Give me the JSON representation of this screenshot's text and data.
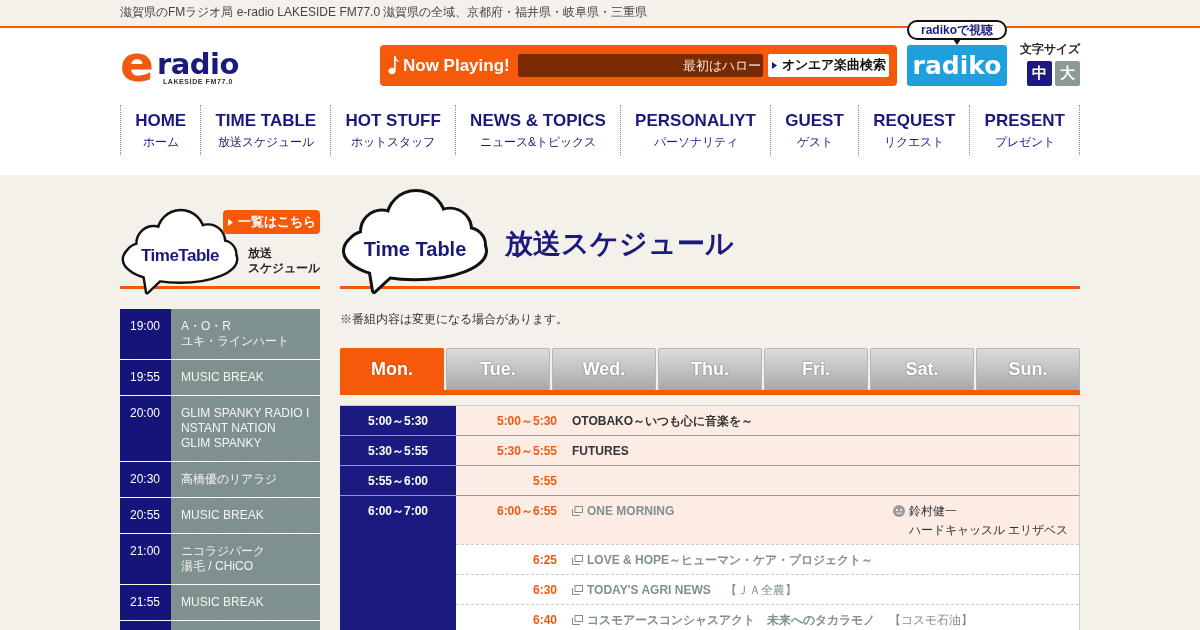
{
  "top_bar": {
    "text": "滋賀県のFMラジオ局 e-radio LAKESIDE FM77.0 滋賀県の全域、京都府・福井県・岐阜県・三重県"
  },
  "logo": {
    "mark": "e",
    "name": "radio",
    "tagline": "LAKESIDE FM77.0"
  },
  "now_playing": {
    "label": "Now Playing!",
    "track": "最初はハロー",
    "search_button": "オンエア楽曲検索"
  },
  "radiko": {
    "bubble": "radikoで視聴",
    "button": "radiko"
  },
  "font_size": {
    "label": "文字サイズ",
    "options": [
      {
        "label": "中",
        "selected": true
      },
      {
        "label": "大",
        "selected": false
      }
    ]
  },
  "nav": [
    {
      "label": "HOME",
      "sub": "ホーム"
    },
    {
      "label": "TIME TABLE",
      "sub": "放送スケジュール"
    },
    {
      "label": "HOT STUFF",
      "sub": "ホットスタッフ"
    },
    {
      "label": "NEWS & TOPICS",
      "sub": "ニュース&トピックス"
    },
    {
      "label": "PERSONALIYT",
      "sub": "パーソナリティ"
    },
    {
      "label": "GUEST",
      "sub": "ゲスト"
    },
    {
      "label": "REQUEST",
      "sub": "リクエスト"
    },
    {
      "label": "PRESENT",
      "sub": "プレゼント"
    }
  ],
  "sidebar": {
    "heading": "TimeTable",
    "view_all": "一覧はこちら",
    "subtitle_lines": [
      "放送",
      "スケジュール"
    ],
    "rows": [
      {
        "time": "19:00",
        "lines": [
          "A・O・R",
          "ユキ・ラインハート"
        ]
      },
      {
        "time": "19:55",
        "lines": [
          "MUSIC BREAK"
        ]
      },
      {
        "time": "20:00",
        "lines": [
          "GLIM SPANKY RADIO INSTANT NATION",
          "GLIM SPANKY"
        ]
      },
      {
        "time": "20:30",
        "lines": [
          "高橋優のリアラジ"
        ]
      },
      {
        "time": "20:55",
        "lines": [
          "MUSIC BREAK"
        ]
      },
      {
        "time": "21:00",
        "lines": [
          "ニコラジパーク",
          "湯毛 / CHiCO"
        ]
      },
      {
        "time": "21:55",
        "lines": [
          "MUSIC BREAK"
        ]
      }
    ]
  },
  "main": {
    "heading": "Time Table",
    "title": "放送スケジュール",
    "note": "※番組内容は変更になる場合があります。",
    "tabs": [
      {
        "label": "Mon.",
        "selected": true
      },
      {
        "label": "Tue.",
        "selected": false
      },
      {
        "label": "Wed.",
        "selected": false
      },
      {
        "label": "Thu.",
        "selected": false
      },
      {
        "label": "Fri.",
        "selected": false
      },
      {
        "label": "Sat.",
        "selected": false
      },
      {
        "label": "Sun.",
        "selected": false
      }
    ],
    "slots": [
      {
        "range": "5:00～5:30",
        "programs": [
          {
            "time": "5:00～5:30",
            "title": "OTOBAKO～いつも心に音楽を～",
            "linked": false,
            "highlighted": true
          }
        ]
      },
      {
        "range": "5:30～5:55",
        "programs": [
          {
            "time": "5:30～5:55",
            "title": "FUTURES",
            "linked": false,
            "highlighted": true
          }
        ]
      },
      {
        "range": "5:55～6:00",
        "programs": [
          {
            "time": "5:55",
            "highlighted": true
          }
        ]
      },
      {
        "range": "6:00～7:00",
        "programs": [
          {
            "time": "6:00～6:55",
            "title": "ONE MORNING",
            "linked": true,
            "highlighted": true,
            "personalities": [
              "鈴村健一",
              "ハードキャッスル エリザベス"
            ]
          },
          {
            "time": "6:25",
            "title": "LOVE & HOPE～ヒューマン・ケア・プロジェクト～",
            "linked": true,
            "highlighted": false
          },
          {
            "time": "6:30",
            "title": "TODAY'S AGRI NEWS",
            "linked": true,
            "highlighted": false,
            "sponsor": "【ＪＡ全農】"
          },
          {
            "time": "6:40",
            "title": "コスモアースコンシャスアクト　未来へのタカラモノ",
            "linked": true,
            "highlighted": false,
            "sponsor": "【コスモ石油】"
          }
        ]
      }
    ]
  }
}
